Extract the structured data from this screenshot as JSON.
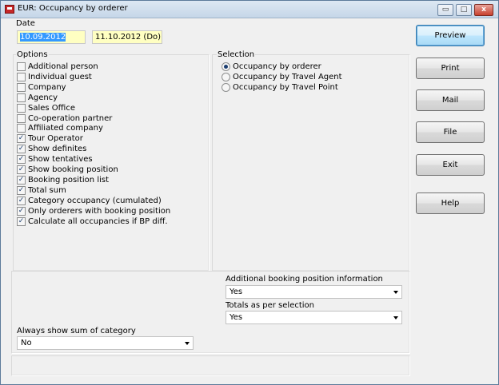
{
  "window": {
    "title": "EUR: Occupancy by orderer",
    "controls": {
      "minimize": "▭",
      "maximize": "□",
      "close": "x"
    }
  },
  "date": {
    "label": "Date",
    "from": "10.09.2012",
    "to": "11.10.2012 (Do)"
  },
  "options": {
    "label": "Options",
    "items": [
      {
        "label": "Additional person",
        "checked": false
      },
      {
        "label": "Individual guest",
        "checked": false
      },
      {
        "label": "Company",
        "checked": false
      },
      {
        "label": "Agency",
        "checked": false
      },
      {
        "label": "Sales Office",
        "checked": false
      },
      {
        "label": "Co-operation partner",
        "checked": false
      },
      {
        "label": "Affiliated company",
        "checked": false
      },
      {
        "label": "Tour Operator",
        "checked": true
      },
      {
        "label": "Show definites",
        "checked": true
      },
      {
        "label": "Show tentatives",
        "checked": true
      },
      {
        "label": "Show booking position",
        "checked": true
      },
      {
        "label": "Booking position list",
        "checked": true
      },
      {
        "label": "Total sum",
        "checked": true
      },
      {
        "label": "Category occupancy (cumulated)",
        "checked": true
      },
      {
        "label": "Only orderers with booking position",
        "checked": true
      },
      {
        "label": "Calculate all occupancies if BP diff.",
        "checked": true
      }
    ]
  },
  "selection": {
    "label": "Selection",
    "items": [
      {
        "label": "Occupancy by orderer",
        "selected": true
      },
      {
        "label": "Occupancy by Travel Agent",
        "selected": false
      },
      {
        "label": "Occupancy by Travel Point",
        "selected": false
      }
    ]
  },
  "additional_info": {
    "label": "Additional booking position information",
    "value": "Yes"
  },
  "totals": {
    "label": "Totals as per selection",
    "value": "Yes"
  },
  "sum_category": {
    "label": "Always show sum of category",
    "value": "No"
  },
  "buttons": {
    "preview": "Preview",
    "print": "Print",
    "mail": "Mail",
    "file": "File",
    "exit": "Exit",
    "help": "Help"
  },
  "check_glyph": "✓"
}
